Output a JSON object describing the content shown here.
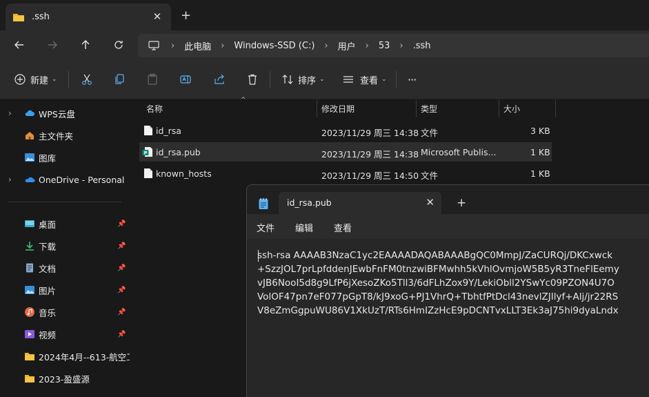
{
  "window": {
    "tab_title": ".ssh",
    "tab_close": "✕",
    "new_tab": "+"
  },
  "address": {
    "breadcrumbs": [
      "此电脑",
      "Windows-SSD (C:)",
      "用户",
      "53",
      ".ssh"
    ],
    "separator": "›"
  },
  "commands": {
    "new_label": "新建",
    "sort_label": "排序",
    "view_label": "查看",
    "more_label": "···"
  },
  "sidebar": {
    "items": [
      {
        "label": "WPS云盘",
        "icon": "cloud-icon",
        "expandable": true
      },
      {
        "label": "主文件夹",
        "icon": "home-icon",
        "expandable": false
      },
      {
        "label": "图库",
        "icon": "gallery-icon",
        "expandable": false
      },
      {
        "label": "OneDrive - Personal",
        "icon": "onedrive-icon",
        "expandable": true
      },
      {
        "label": "桌面",
        "icon": "desktop-icon",
        "pinned": true
      },
      {
        "label": "下载",
        "icon": "download-icon",
        "pinned": true
      },
      {
        "label": "文档",
        "icon": "document-icon",
        "pinned": true
      },
      {
        "label": "图片",
        "icon": "pictures-icon",
        "pinned": true
      },
      {
        "label": "音乐",
        "icon": "music-icon",
        "pinned": true
      },
      {
        "label": "视频",
        "icon": "video-icon",
        "pinned": true
      },
      {
        "label": "2024年4月--613-航空工",
        "icon": "folder-icon",
        "pinned": false
      },
      {
        "label": "2023-盈盛源",
        "icon": "folder-icon",
        "pinned": false
      }
    ]
  },
  "filelist": {
    "columns": [
      "名称",
      "修改日期",
      "类型",
      "大小"
    ],
    "rows": [
      {
        "name": "id_rsa",
        "date": "2023/11/29 周三 14:38",
        "type": "文件",
        "size": "3 KB"
      },
      {
        "name": "id_rsa.pub",
        "date": "2023/11/29 周三 14:38",
        "type": "Microsoft Publis...",
        "size": "1 KB"
      },
      {
        "name": "known_hosts",
        "date": "2023/11/29 周三 14:50",
        "type": "文件",
        "size": "1 KB"
      }
    ]
  },
  "notepad": {
    "tab_title": "id_rsa.pub",
    "tab_close": "✕",
    "new_tab": "+",
    "menu": [
      "文件",
      "编辑",
      "查看"
    ],
    "lines": [
      "ssh-rsa AAAAB3NzaC1yc2EAAAADAQABAAABgQC0MmpJ/ZaCURQj/DKCxwck",
      "+SzzJOL7prLpfddenJEwbFnFM0tnzwiBFMwhh5kVhlOvmjoW5B5yR3TneFlEemy",
      "vJB6NooI5d8g9LfP6jXesoZKo5Tll3/6dFLhZox9Y/LekiObll2YSwYc09PZON4U7O",
      "VolOF47pn7eF077pGpT8/kJ9xoG+PJ1VhrQ+TbhtfPtDcl43nevlZJIlyf+Alj/jr22RS",
      "V8eZmGgpuWU86V1XkUzT/RTs6HmIZzHcE9pDCNTvxLLT3Ek3aJ75hi9dyaLndx"
    ]
  }
}
